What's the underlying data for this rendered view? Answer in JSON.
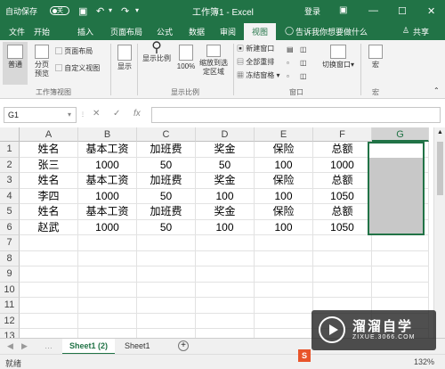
{
  "titlebar": {
    "autosave": "自动保存",
    "autosave_state": "关",
    "title": "工作簿1 - Excel",
    "login": "登录"
  },
  "tabs": [
    "文件",
    "开始",
    "插入",
    "页面布局",
    "公式",
    "数据",
    "审阅",
    "视图"
  ],
  "active_tab": "视图",
  "search_hint": "告诉我你想要做什么",
  "share": "共享",
  "ribbon": {
    "normal": "普通",
    "page_break": "分页预览",
    "page_layout": "页面布局",
    "custom_view": "自定义视图",
    "group_views": "工作簿视图",
    "show": "显示",
    "zoom": "显示比例",
    "zoom100": "100%",
    "zoom_sel": "缩放到选定区域",
    "group_zoom": "显示比例",
    "new_window": "新建窗口",
    "arrange_all": "全部重排",
    "freeze": "冻结窗格",
    "switch_window": "切换窗口",
    "group_window": "窗口",
    "macro": "宏",
    "group_macro": "宏"
  },
  "formula": {
    "namebox": "G1",
    "fx": "fx",
    "value": ""
  },
  "grid": {
    "columns": [
      "A",
      "B",
      "C",
      "D",
      "E",
      "F",
      "G"
    ],
    "rows": [
      "1",
      "2",
      "3",
      "4",
      "5",
      "6",
      "7",
      "8",
      "9",
      "10",
      "11",
      "12",
      "13"
    ],
    "cells": [
      [
        "姓名",
        "基本工资",
        "加班费",
        "奖金",
        "保险",
        "总额"
      ],
      [
        "张三",
        "1000",
        "50",
        "50",
        "100",
        "1000"
      ],
      [
        "姓名",
        "基本工资",
        "加班费",
        "奖金",
        "保险",
        "总额"
      ],
      [
        "李四",
        "1000",
        "50",
        "100",
        "100",
        "1050"
      ],
      [
        "姓名",
        "基本工资",
        "加班费",
        "奖金",
        "保险",
        "总额"
      ],
      [
        "赵武",
        "1000",
        "50",
        "100",
        "100",
        "1050"
      ]
    ]
  },
  "sheets": [
    "Sheet1 (2)",
    "Sheet1"
  ],
  "active_sheet": "Sheet1 (2)",
  "status": {
    "ready": "就绪",
    "zoom": "132%"
  },
  "watermark": {
    "title": "溜溜自学",
    "url": "ZIXUE.3066.COM"
  },
  "colors": {
    "excel_green": "#217346",
    "selection_fill": "#c8c8c8"
  }
}
